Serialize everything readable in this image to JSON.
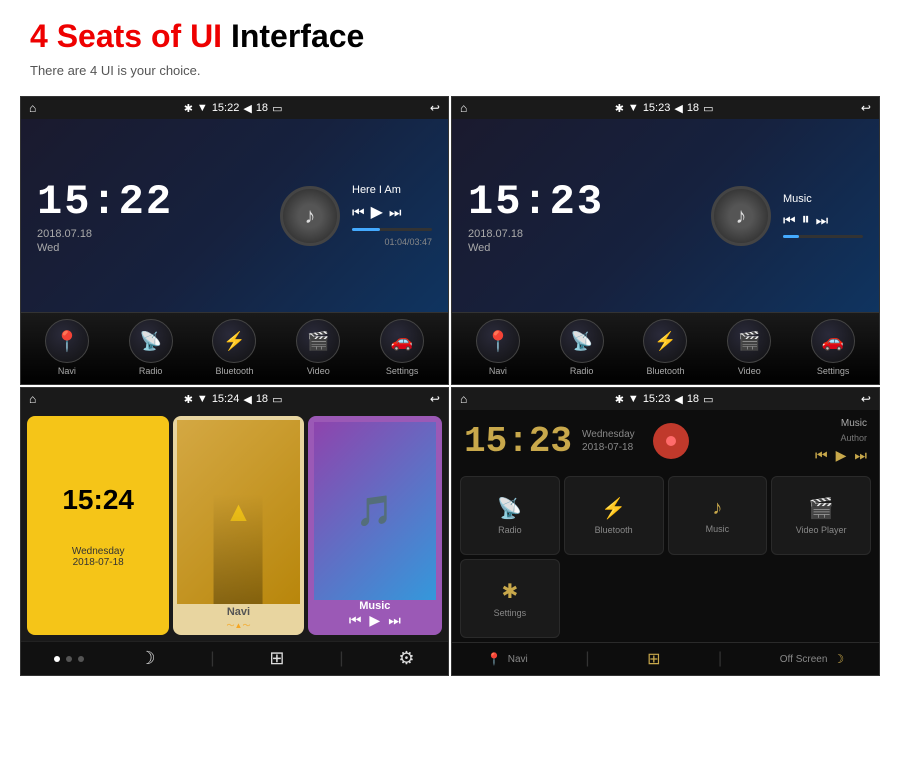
{
  "header": {
    "title_red": "4 Seats of UI",
    "title_black": " Interface",
    "subtitle": "There are 4 UI is your choice."
  },
  "screen1": {
    "time": "15:22",
    "date": "2018.07.18",
    "day": "Wed",
    "song": "Here I Am",
    "song_time": "01:04/03:47",
    "status_time": "15:22",
    "status_battery": "18",
    "nav": [
      "Navi",
      "Radio",
      "Bluetooth",
      "Video",
      "Settings"
    ]
  },
  "screen2": {
    "time": "15:23",
    "date": "2018.07.18",
    "day": "Wed",
    "song": "Music",
    "status_time": "15:23",
    "status_battery": "18",
    "nav": [
      "Navi",
      "Radio",
      "Bluetooth",
      "Video",
      "Settings"
    ]
  },
  "screen3": {
    "time": "15:24",
    "date_day": "Wednesday",
    "date": "2018-07-18",
    "status_time": "15:24",
    "status_battery": "18",
    "cards": [
      "clock",
      "Navi",
      "Music"
    ]
  },
  "screen4": {
    "time": "15:23",
    "date_day": "Wednesday",
    "date": "2018-07-18",
    "status_time": "15:23",
    "status_battery": "18",
    "music_label": "Music",
    "music_author": "Author",
    "nav": [
      "Radio",
      "Bluetooth",
      "Music",
      "Video Player",
      "Settings"
    ],
    "bottom": [
      "Navi",
      "Off Screen"
    ]
  }
}
